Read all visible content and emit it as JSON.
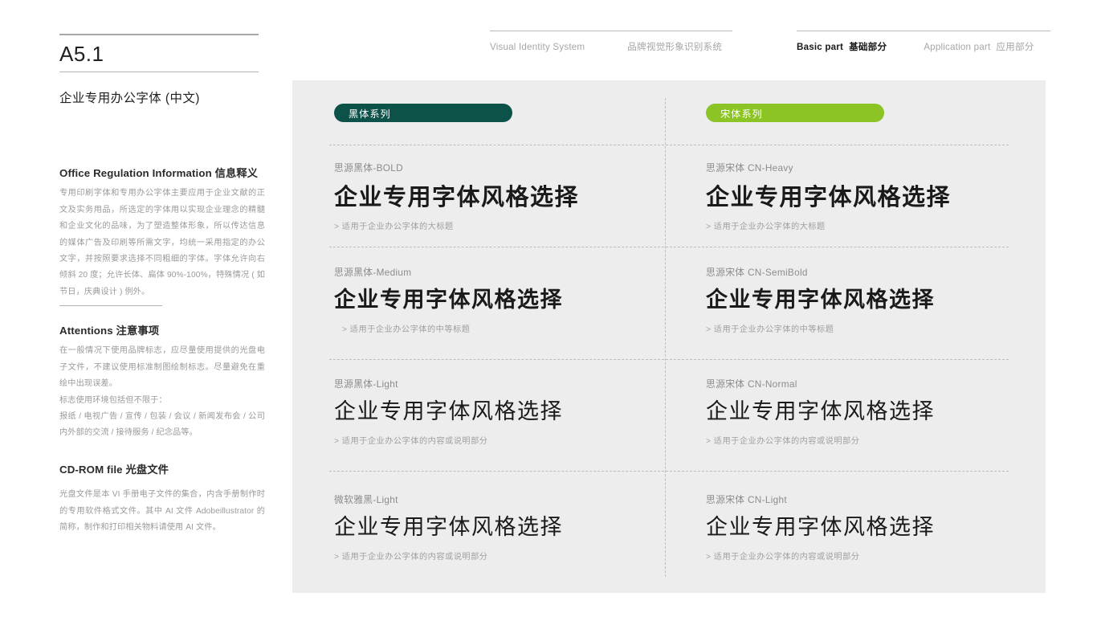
{
  "sidebar": {
    "code": "A5.1",
    "section_title": "企业专用办公字体 (中文)",
    "blocks": [
      {
        "heading_en": "Office Regulation Information",
        "heading_cn": "信息释义",
        "body": "专用印刷字体和专用办公字体主要应用于企业文献的正文及实务用品，所选定的字体用以实现企业理念的精髓和企业文化的品味，为了塑造整体形象，所以传达信息的媒体广告及印刷等所需文字，均统一采用指定的办公文字，并按照要求选择不同粗细的字体。字体允许向右倾斜 20 度；允许长体、扁体 90%-100%，特殊情况 ( 如节日，庆典设计 ) 例外。"
      },
      {
        "heading_en": "Attentions",
        "heading_cn": "注意事项",
        "body": "在一般情况下使用品牌标志，应尽量使用提供的光盘电子文件，不建议使用标准制图绘制标志。尽量避免在重绘中出现误差。\n标志使用环境包括但不限于：\n报纸 / 电视广告 / 宣传 / 包装 / 会议 / 新闻发布会 / 公司内外部的交流 / 接待服务 / 纪念品等。"
      },
      {
        "heading_en": "CD-ROM file",
        "heading_cn": "光盘文件",
        "body": "光盘文件是本 VI 手册电子文件的集合，内含手册制作时的专用软件格式文件。其中 AI 文件 Adobeillustrator 的简称，制作和打印相关物料请使用 AI 文件。"
      }
    ]
  },
  "topnav": {
    "left": {
      "en": "Visual Identity System",
      "cn": "品牌视觉形象识别系统"
    },
    "right_active": {
      "en": "Basic part",
      "cn": "基础部分"
    },
    "right_inactive": {
      "en": "Application part",
      "cn": "应用部分"
    }
  },
  "panel": {
    "background": "#ededed",
    "pills": [
      {
        "label": "黑体系列",
        "color": "#0d5249"
      },
      {
        "label": "宋体系列",
        "color": "#8cc425"
      }
    ],
    "samples_left": [
      {
        "name": "思源黑体-BOLD",
        "sample": "企业专用字体风格选择",
        "note": "> 适用于企业办公字体的大标题"
      },
      {
        "name": "思源黑体-Medium",
        "sample": "企业专用字体风格选择",
        "note": "> 适用于企业办公字体的中等标题"
      },
      {
        "name": "思源黑体-Light",
        "sample": "企业专用字体风格选择",
        "note": "> 适用于企业办公字体的内容或说明部分"
      },
      {
        "name": "微软雅黑-Light",
        "sample": "企业专用字体风格选择",
        "note": "> 适用于企业办公字体的内容或说明部分"
      }
    ],
    "samples_right": [
      {
        "name": "思源宋体 CN-Heavy",
        "sample": "企业专用字体风格选择",
        "note": "> 适用于企业办公字体的大标题"
      },
      {
        "name": "思源宋体 CN-SemiBold",
        "sample": "企业专用字体风格选择",
        "note": "> 适用于企业办公字体的中等标题"
      },
      {
        "name": "思源宋体 CN-Normal",
        "sample": "企业专用字体风格选择",
        "note": "> 适用于企业办公字体的内容或说明部分"
      },
      {
        "name": "思源宋体 CN-Light",
        "sample": "企业专用字体风格选择",
        "note": "> 适用于企业办公字体的内容或说明部分"
      }
    ]
  }
}
